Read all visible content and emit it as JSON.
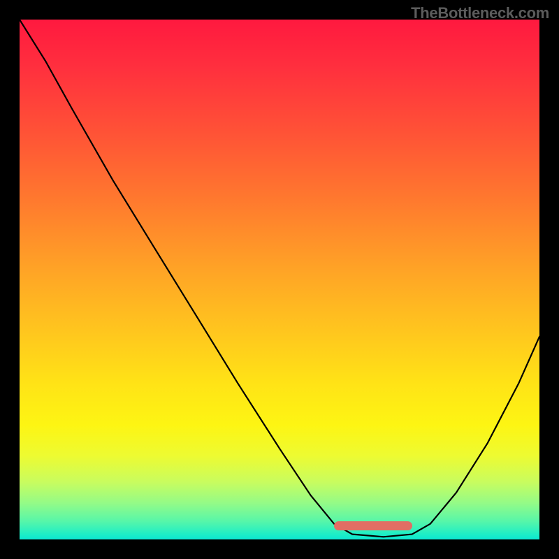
{
  "watermark": "TheBottleneck.com",
  "colors": {
    "page_bg": "#000000",
    "curve_stroke": "#000000",
    "optimal_marker": "#e16e64",
    "gradient_stops": [
      {
        "pos": 0.0,
        "color": "#ff193f"
      },
      {
        "pos": 0.09,
        "color": "#ff2f3e"
      },
      {
        "pos": 0.22,
        "color": "#ff5336"
      },
      {
        "pos": 0.35,
        "color": "#ff7a2e"
      },
      {
        "pos": 0.48,
        "color": "#ffa326"
      },
      {
        "pos": 0.6,
        "color": "#ffc61e"
      },
      {
        "pos": 0.7,
        "color": "#ffe316"
      },
      {
        "pos": 0.78,
        "color": "#fdf513"
      },
      {
        "pos": 0.84,
        "color": "#edfb32"
      },
      {
        "pos": 0.89,
        "color": "#c8fc5f"
      },
      {
        "pos": 0.93,
        "color": "#94fb87"
      },
      {
        "pos": 0.965,
        "color": "#57f6a9"
      },
      {
        "pos": 0.99,
        "color": "#1eeec6"
      },
      {
        "pos": 1.0,
        "color": "#0be7d2"
      }
    ]
  },
  "chart_data": {
    "type": "line",
    "title": "",
    "xlabel": "",
    "ylabel": "",
    "x_range": [
      0,
      1
    ],
    "y_range": [
      0,
      1
    ],
    "note": "Axes are unlabeled; values normalized 0–1. y=1 red (bad), y=0 green (optimal). Curve is a V-shaped bottleneck profile with a flat minimum.",
    "series": [
      {
        "name": "bottleneck-curve",
        "x": [
          0.0,
          0.05,
          0.1,
          0.18,
          0.26,
          0.34,
          0.42,
          0.5,
          0.56,
          0.605,
          0.64,
          0.7,
          0.755,
          0.79,
          0.84,
          0.9,
          0.96,
          1.0
        ],
        "y": [
          1.0,
          0.92,
          0.83,
          0.69,
          0.56,
          0.43,
          0.3,
          0.175,
          0.085,
          0.03,
          0.01,
          0.005,
          0.01,
          0.03,
          0.09,
          0.185,
          0.3,
          0.39
        ]
      }
    ],
    "optimal_range_x": [
      0.605,
      0.755
    ],
    "annotations": []
  }
}
